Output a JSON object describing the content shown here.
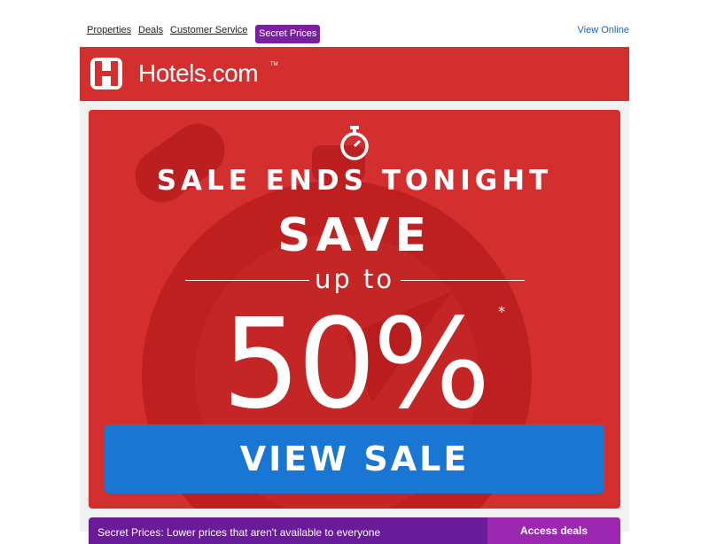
{
  "nav": {
    "links": [
      "Properties",
      "Deals",
      "Customer Service"
    ],
    "secret_prices": "Secret Prices",
    "view_online": "View Online"
  },
  "brand": {
    "name": "Hotels.com",
    "tm": "TM",
    "color": "#d32f2f"
  },
  "hero": {
    "headline": "SALE ENDS TONIGHT",
    "save": "SAVE",
    "up_to": "up to",
    "percent": "50%",
    "asterisk": "*",
    "cta": "VIEW SALE",
    "accent": "#1976d2",
    "icon": "stopwatch-icon"
  },
  "secret_strip": {
    "message": "Secret Prices: Lower prices that aren't available to everyone",
    "button": "Access deals",
    "color": "#6a1b9a"
  }
}
